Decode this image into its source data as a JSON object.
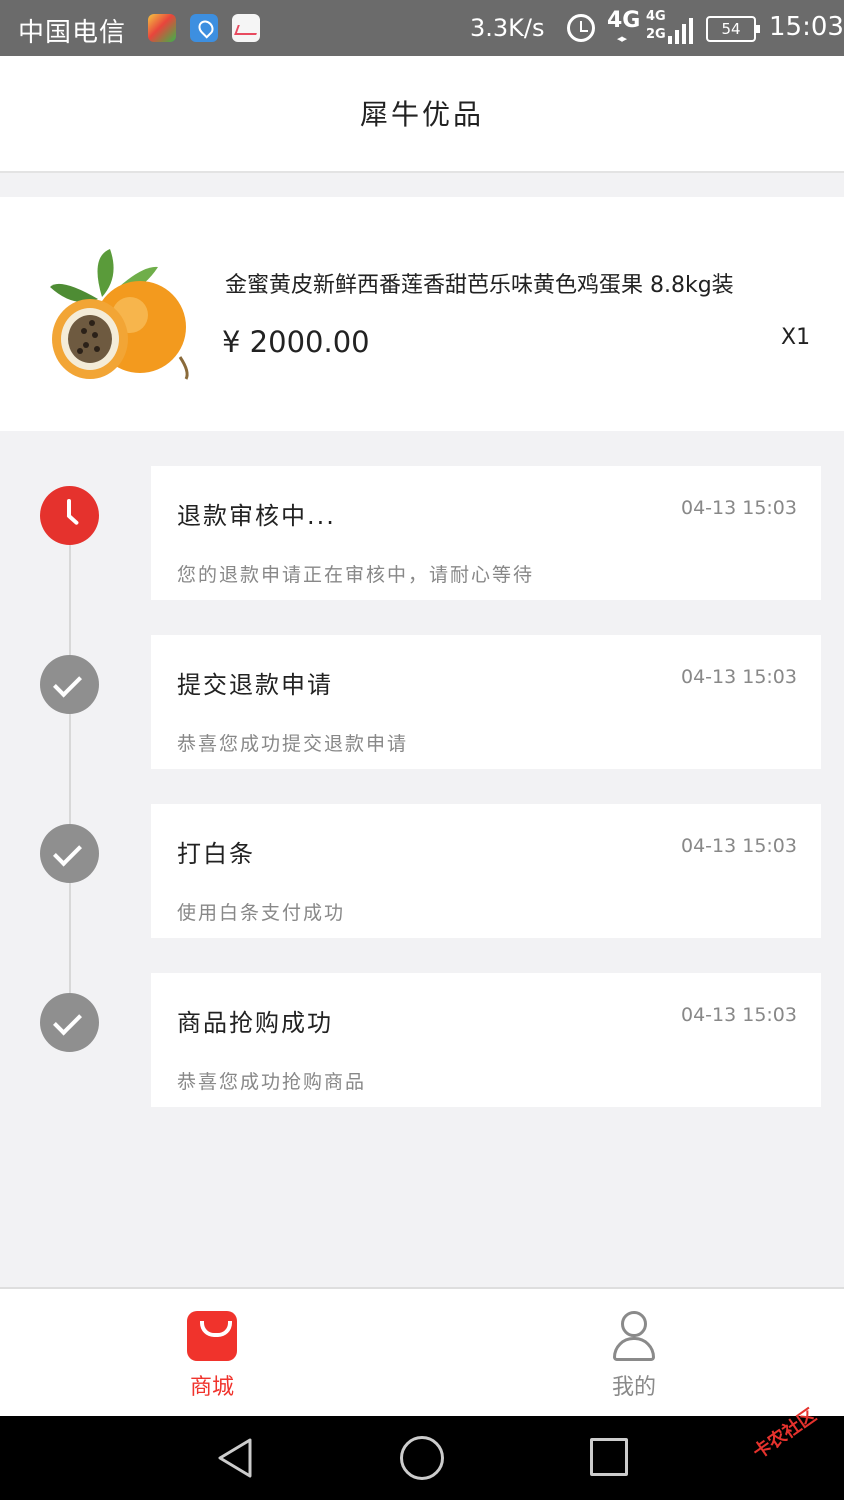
{
  "status_bar": {
    "carrier": "中国电信",
    "net_speed": "3.3K/s",
    "network": "4G",
    "dual_sim": [
      "4G",
      "2G"
    ],
    "battery": "54",
    "time": "15:03"
  },
  "header": {
    "title": "犀牛优品"
  },
  "product": {
    "name": "金蜜黄皮新鲜西番莲香甜芭乐味黄色鸡蛋果 8.8kg装",
    "price": "¥ 2000.00",
    "quantity": "X1"
  },
  "timeline": [
    {
      "title": "退款审核中...",
      "time": "04-13 15:03",
      "desc": "您的退款申请正在审核中，请耐心等待",
      "icon": "clock-icon",
      "status": "current"
    },
    {
      "title": "提交退款申请",
      "time": "04-13 15:03",
      "desc": "恭喜您成功提交退款申请",
      "icon": "check-icon",
      "status": "done"
    },
    {
      "title": "打白条",
      "time": "04-13 15:03",
      "desc": "使用白条支付成功",
      "icon": "check-icon",
      "status": "done"
    },
    {
      "title": "商品抢购成功",
      "time": "04-13 15:03",
      "desc": "恭喜您成功抢购商品",
      "icon": "check-icon",
      "status": "done"
    }
  ],
  "tabbar": {
    "mall_label": "商城",
    "mine_label": "我的",
    "active_color": "#f0332c",
    "inactive_color": "#8a8a8a"
  },
  "watermark": "卡农社区",
  "colors": {
    "accent": "#e5322d",
    "done": "#8f8f8f",
    "background": "#f2f2f4"
  }
}
